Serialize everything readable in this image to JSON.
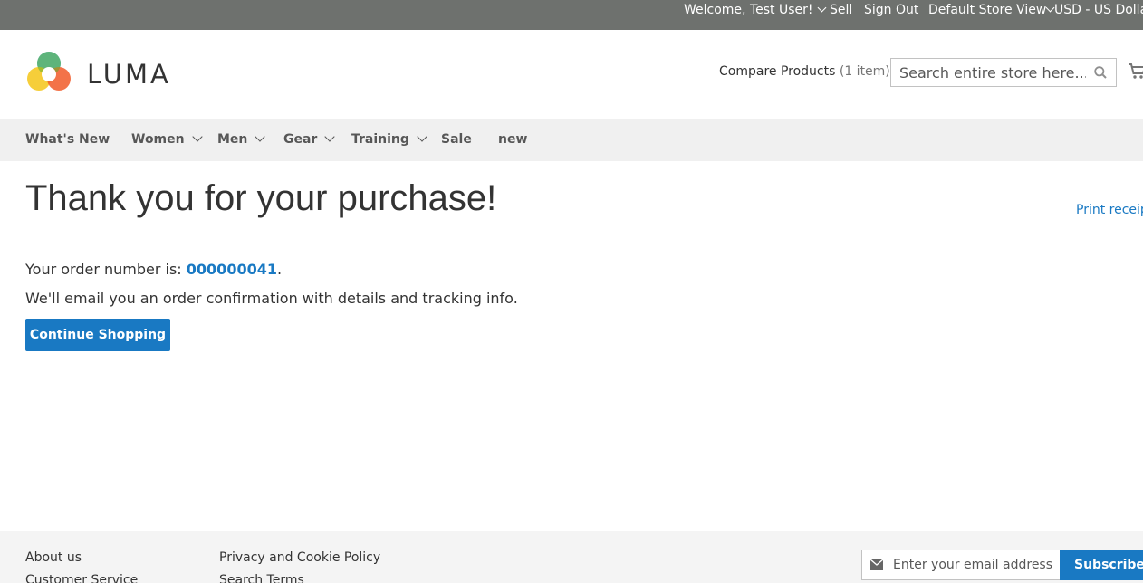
{
  "topbar": {
    "welcome": "Welcome, Test User!",
    "sell": "Sell",
    "sign_out": "Sign Out",
    "store_view": "Default Store View",
    "currency": "USD - US Dollar"
  },
  "header": {
    "logo_text": "LUMA",
    "compare_label": "Compare Products",
    "compare_count": "(1 item)",
    "search_placeholder": "Search entire store here...",
    "icons": [
      "search-icon",
      "cart-icon"
    ]
  },
  "nav": {
    "items": [
      {
        "label": "What's New",
        "dropdown": false
      },
      {
        "label": "Women",
        "dropdown": true
      },
      {
        "label": "Men",
        "dropdown": true
      },
      {
        "label": "Gear",
        "dropdown": true
      },
      {
        "label": "Training",
        "dropdown": true
      },
      {
        "label": "Sale",
        "dropdown": false
      },
      {
        "label": "new",
        "dropdown": false
      }
    ]
  },
  "main": {
    "title": "Thank you for your purchase!",
    "print_receipt": "Print receipt",
    "order_prefix": "Your order number is: ",
    "order_number": "000000041",
    "order_suffix": ".",
    "email_info": "We'll email you an order confirmation with details and tracking info.",
    "continue_button": "Continue Shopping"
  },
  "footer": {
    "col1": [
      "About us",
      "Customer Service"
    ],
    "col2": [
      "Privacy and Cookie Policy",
      "Search Terms"
    ],
    "newsletter_placeholder": "Enter your email address",
    "subscribe_button": "Subscribe"
  },
  "colors": {
    "topbar_bg": "#6e716e",
    "nav_bg": "#f0f0f0",
    "accent": "#1979c3",
    "footer_bg": "#f4f4f4"
  }
}
